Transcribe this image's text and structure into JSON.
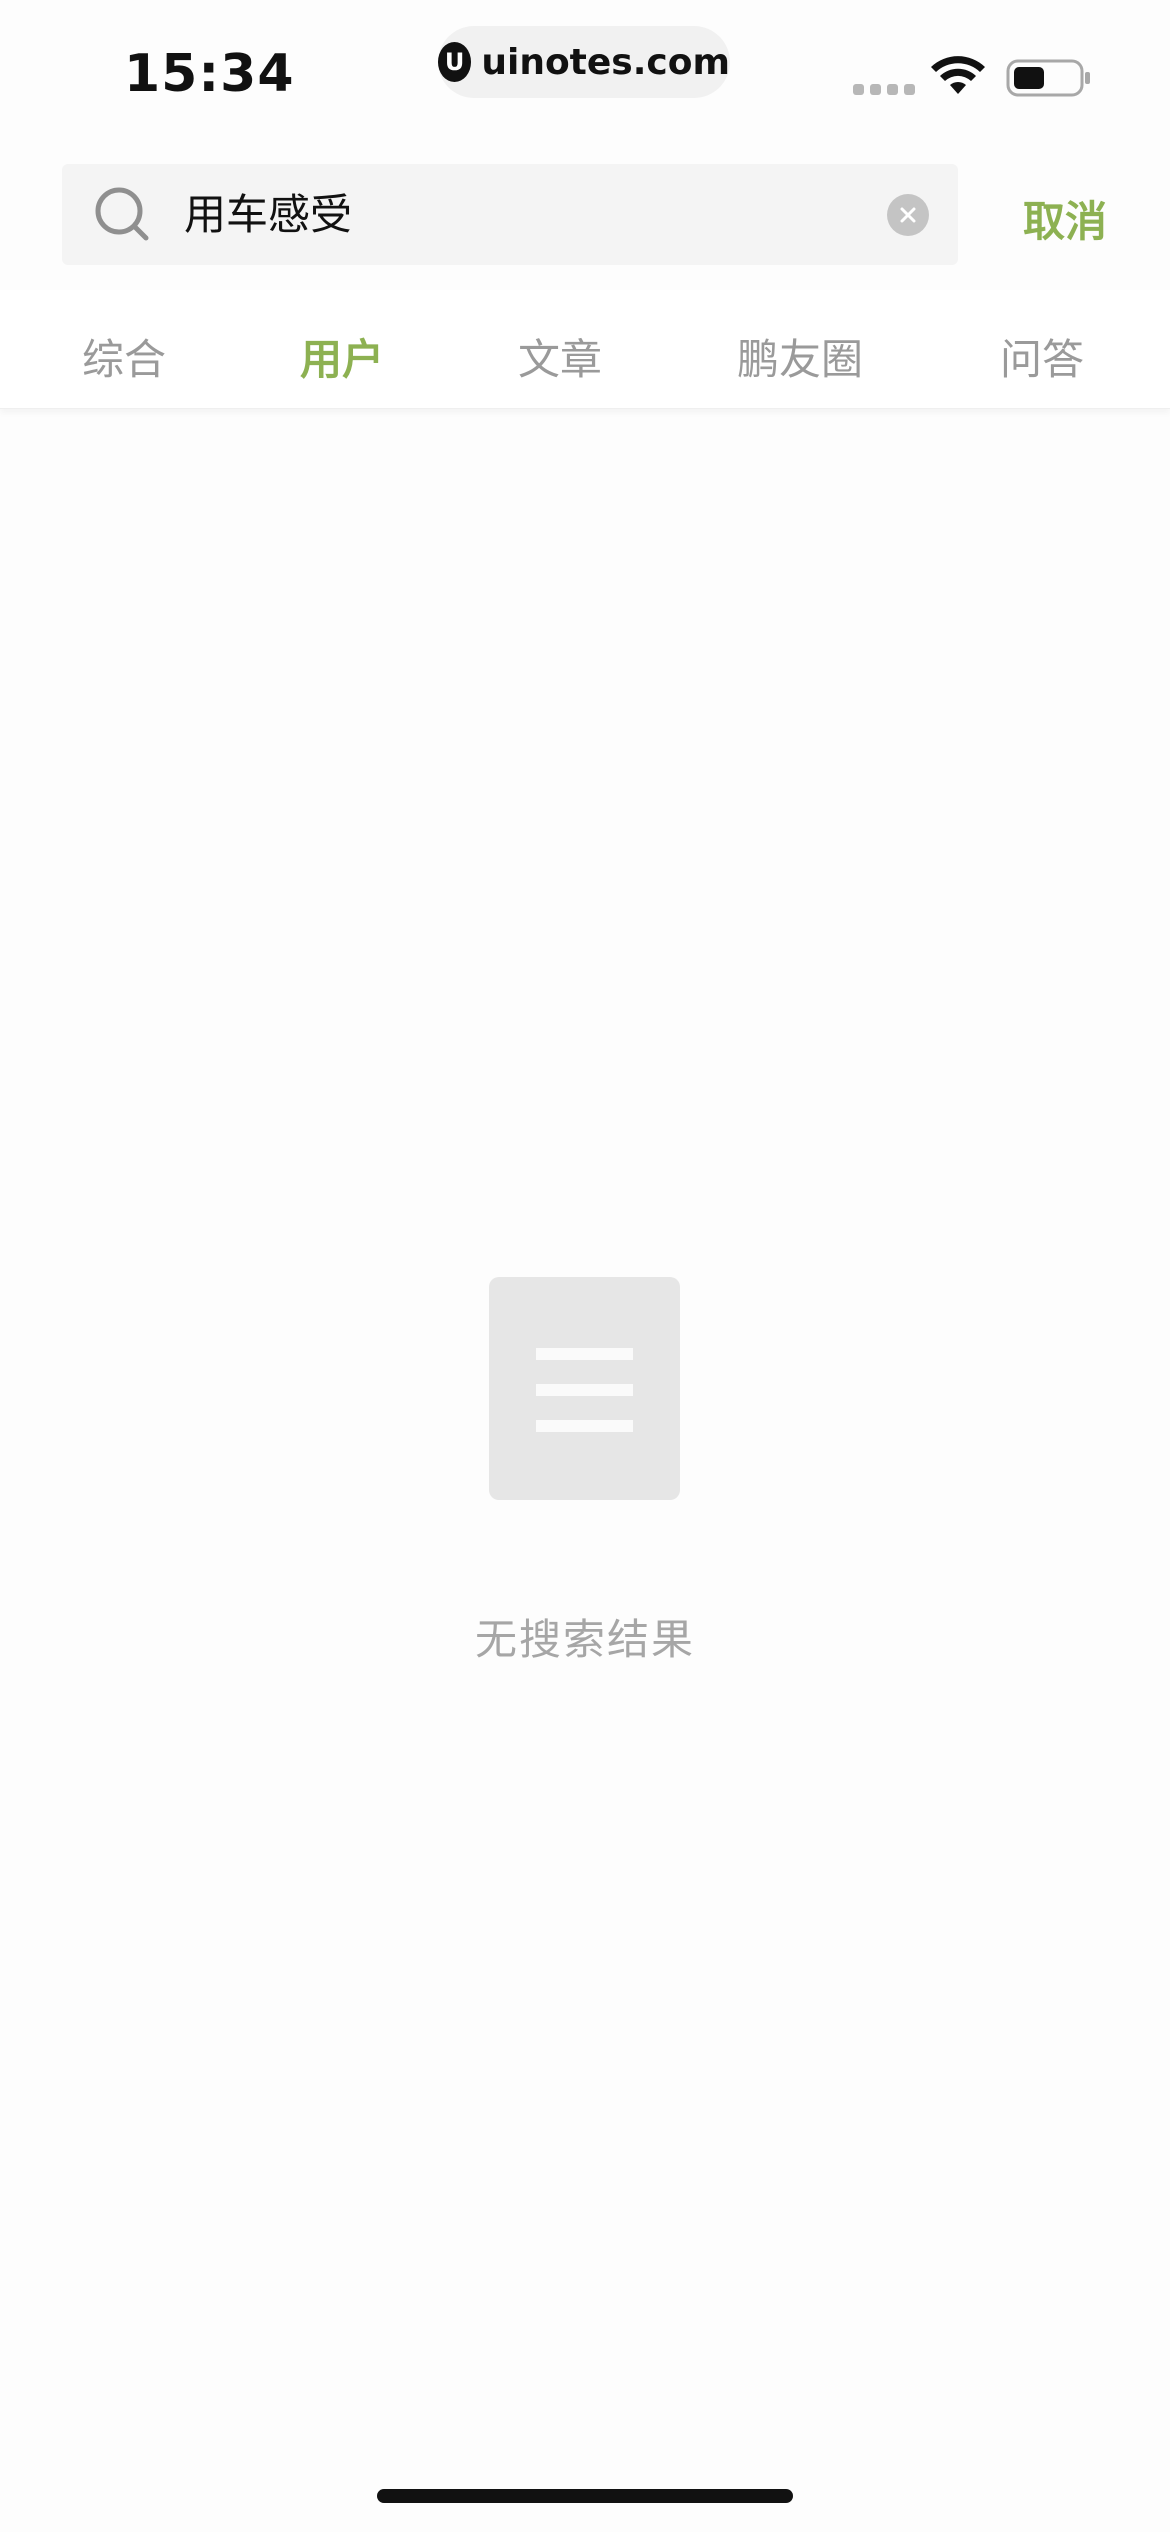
{
  "status_bar": {
    "time": "15:34",
    "url": "uinotes.com",
    "url_logo": "U"
  },
  "search": {
    "query": "用车感受",
    "cancel_label": "取消"
  },
  "tabs": [
    {
      "label": "综合",
      "active": false
    },
    {
      "label": "用户",
      "active": true
    },
    {
      "label": "文章",
      "active": false
    },
    {
      "label": "鹏友圈",
      "active": false
    },
    {
      "label": "问答",
      "active": false
    }
  ],
  "empty_state": {
    "message": "无搜索结果"
  },
  "colors": {
    "accent": "#8db152",
    "inactive_tab": "#9a9a9a",
    "search_bg": "#f4f4f4",
    "empty_icon": "#e6e6e6"
  },
  "icons": {
    "search": "search-icon",
    "clear": "clear-icon",
    "wifi": "wifi-icon",
    "battery": "battery-icon",
    "empty": "document-icon"
  }
}
